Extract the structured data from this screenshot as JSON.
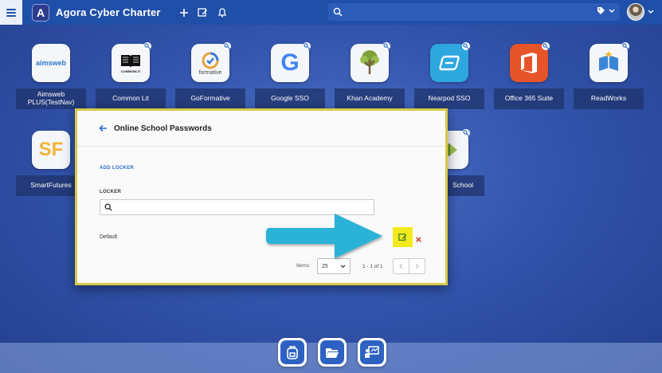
{
  "topbar": {
    "logo_letter": "A",
    "title": "Agora Cyber Charter",
    "icons": [
      "plus-icon",
      "edit-icon",
      "bell-icon"
    ],
    "search_placeholder": ""
  },
  "apps": [
    {
      "label": "Aimsweb PLUS(TestNav)",
      "icon_text": "aimsweb",
      "icon": "aimsweb-icon"
    },
    {
      "label": "Common Lit",
      "icon_text": "COMMONLIT",
      "icon": "commonlit-book-icon"
    },
    {
      "label": "GoFormative",
      "icon_text": "formative",
      "icon": "formative-icon"
    },
    {
      "label": "Google SSO",
      "icon_text": "G",
      "icon": "google-icon"
    },
    {
      "label": "Khan Academy",
      "icon_text": "",
      "icon": "khan-tree-icon"
    },
    {
      "label": "Nearpod SSO",
      "icon_text": "",
      "icon": "nearpod-icon"
    },
    {
      "label": "Office 365 Suite",
      "icon_text": "",
      "icon": "office-icon"
    },
    {
      "label": "ReadWorks",
      "icon_text": "",
      "icon": "readworks-icon"
    },
    {
      "label": "SmartFutures",
      "icon_text": "SF",
      "icon": "smartfutures-icon"
    },
    {
      "label": "School",
      "icon_text": "",
      "icon": "school-app-icon"
    }
  ],
  "modal": {
    "title": "Online School Passwords",
    "add_locker": "ADD LOCKER",
    "locker_label": "LOCKER",
    "search_value": "",
    "rows": [
      {
        "name": "Default"
      }
    ],
    "items_label": "Items:",
    "items_per_page": "25",
    "page_count": "1 - 1 of 1"
  },
  "colors": {
    "topbar": "#1f4fa8",
    "highlight_border": "#d8c84a",
    "edit_highlight": "#f3ea1d",
    "arrow": "#29b3d6",
    "delete": "#d9302b"
  },
  "dock": [
    "backpack-icon",
    "folder-open-icon",
    "presentation-icon"
  ]
}
